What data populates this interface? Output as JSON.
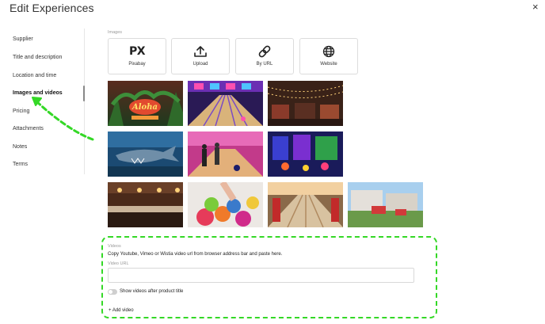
{
  "header": {
    "title": "Edit Experiences",
    "close_label": "×"
  },
  "sidebar": {
    "items": [
      {
        "label": "Supplier"
      },
      {
        "label": "Title and description"
      },
      {
        "label": "Location and time"
      },
      {
        "label": "Images and videos",
        "active": true
      },
      {
        "label": "Pricing"
      },
      {
        "label": "Attachments"
      },
      {
        "label": "Notes"
      },
      {
        "label": "Terms"
      }
    ]
  },
  "images": {
    "section_label": "Images",
    "sources": [
      {
        "label": "Pixabay",
        "icon": "pixabay-icon",
        "mark": "PX"
      },
      {
        "label": "Upload",
        "icon": "upload-icon"
      },
      {
        "label": "By URL",
        "icon": "link-icon"
      },
      {
        "label": "Website",
        "icon": "globe-icon"
      }
    ],
    "thumbnails": [
      {
        "subject": "aloha-tiki-bar",
        "sign_text": "Aloha"
      },
      {
        "subject": "bowling-lanes-purple"
      },
      {
        "subject": "restaurant-lights"
      },
      {
        "subject": "shark-mural"
      },
      {
        "subject": "pink-bowling-alley"
      },
      {
        "subject": "arcade-neon"
      },
      {
        "subject": "bar-interior"
      },
      {
        "subject": "bowling-balls"
      },
      {
        "subject": "bowling-lanes-bright"
      },
      {
        "subject": "outdoor-patio"
      }
    ]
  },
  "videos": {
    "section_label": "Videos",
    "help_text": "Copy Youtube, Vimeo or Wistia video url from browser address bar and paste here.",
    "url_label": "Video URL",
    "url_value": "",
    "url_placeholder": "",
    "toggle_label": "Show videos after product title",
    "toggle_on": false,
    "add_label": "+ Add video"
  },
  "colors": {
    "highlight": "#34d826",
    "border": "#dcdcdc",
    "muted_text": "#999999"
  }
}
